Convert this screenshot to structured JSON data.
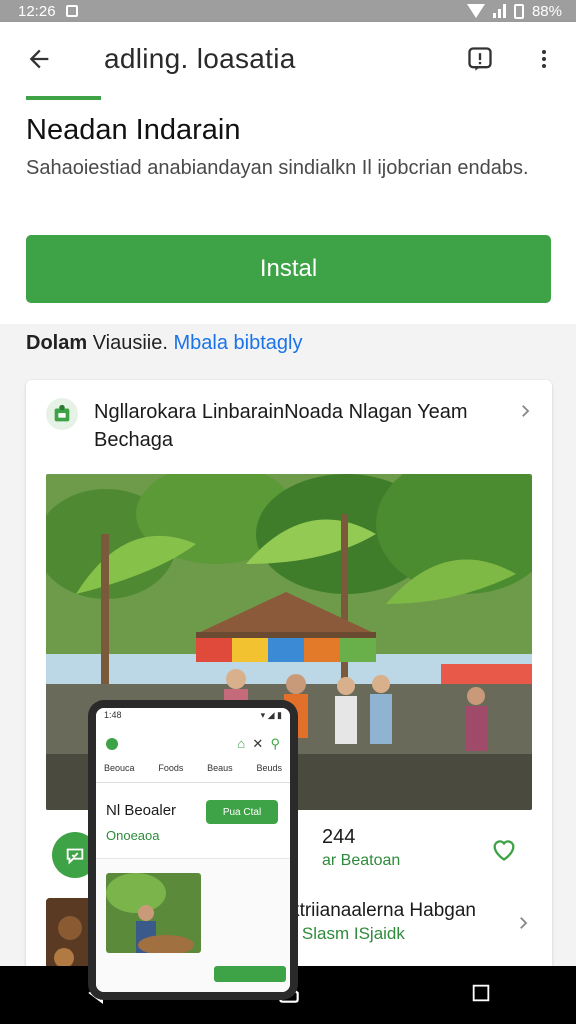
{
  "status_bar": {
    "time": "12:26",
    "battery": "88%"
  },
  "app_bar": {
    "title": "adling. loasatia"
  },
  "heading": "Neadan Indarain",
  "description": "Sahaoiestiad anabiandayan sindialkn Il ijobcrian endabs.",
  "install_button": "Instal",
  "section": {
    "prefix": "Dolam",
    "middle": "Viausiie.",
    "link": "Mbala bibtagly"
  },
  "card": {
    "title": "Ngllarokara LinbarainNoada Nlagan Yeam Bechaga",
    "row1": {
      "number": "244",
      "subtitle": "ar Beatoan"
    },
    "row2": {
      "title": "Kabdabaktriianaalerna Habgan",
      "subtitle": "Nandanan. Slasm ISjaidk"
    }
  },
  "phone": {
    "status_time": "1:48",
    "tabs": [
      "Beouca",
      "Foods",
      "Beaus",
      "Beuds"
    ],
    "title": "Nl Beoaler",
    "subtitle": "Onoeaoa",
    "button": "Pua Ctal"
  },
  "colors": {
    "accent": "#3ea346",
    "link": "#1a73e8"
  },
  "icons": [
    "back-arrow-icon",
    "report-icon",
    "more-vert-icon",
    "chevron-right-icon",
    "heart-icon",
    "nav-back-icon",
    "nav-home-icon",
    "nav-recents-icon"
  ]
}
